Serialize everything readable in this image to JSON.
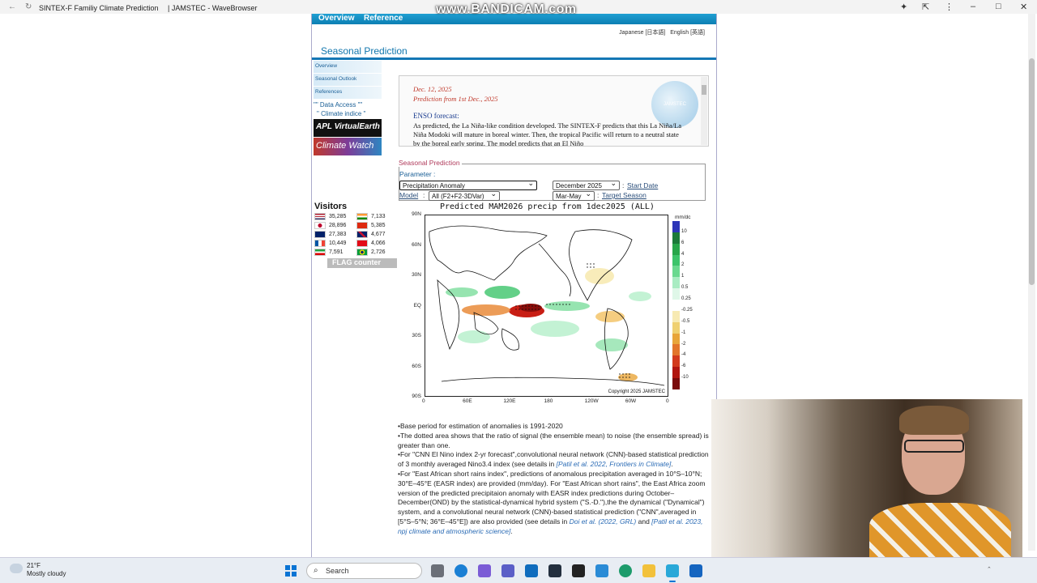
{
  "window": {
    "title": "SINTEX-F Familiy Climate Prediction 　| JAMSTEC - WaveBrowser"
  },
  "watermark": "www.BANDICAM.com",
  "topnav": {
    "items": [
      "Overview",
      "Reference"
    ]
  },
  "language": {
    "japanese": "Japanese [日本語]",
    "english": "English [英語]"
  },
  "page_title": "Seasonal Prediction",
  "sidebar": {
    "menu": [
      "Overview",
      "Seasonal Outlook",
      "References"
    ],
    "links": [
      "\"\" Data Access \"\"",
      "\" Climate indice \""
    ],
    "banners": [
      "APL VirtualEarth",
      "Climate Watch"
    ]
  },
  "visitors": {
    "title": "Visitors",
    "counts": [
      {
        "flag": "us",
        "count": "35,285"
      },
      {
        "flag": "in",
        "count": "7,133"
      },
      {
        "flag": "jp",
        "count": "28,896"
      },
      {
        "flag": "cn",
        "count": "5,385"
      },
      {
        "flag": "au",
        "count": "27,383"
      },
      {
        "flag": "gb",
        "count": "4,677"
      },
      {
        "flag": "fr",
        "count": "10,449"
      },
      {
        "flag": "tr",
        "count": "4,066"
      },
      {
        "flag": "ir",
        "count": "7,591"
      },
      {
        "flag": "br",
        "count": "2,726"
      }
    ],
    "flag_counter": "FLAG counter"
  },
  "news": {
    "date": "Dec. 12, 2025",
    "prediction_from": "Prediction from 1st Dec., 2025",
    "heading": "ENSO forecast:",
    "body": "As predicted, the La Niña-like condition developed. The SINTEX-F predicts that this La Niña/La Niña Modoki will mature in boreal winter. Then, the tropical Pacific will return to a neutral state by the boreal early spring. The model predicts that an El Niño",
    "logo_text": "JAMSTEC"
  },
  "seasonal_form": {
    "legend": "Seasonal Prediction",
    "parameter_label": "Parameter :",
    "parameter_value": "Precipitation Anomaly",
    "start_date_value": "December 2025",
    "start_date_label": "Start Date",
    "model_label": "Model",
    "model_value": "All (F2+F2-3DVar)",
    "target_season_value": "Mar-May",
    "target_season_label": "Target Season"
  },
  "map": {
    "title": "Predicted MAM2026 precip from 1dec2025 (ALL)",
    "y_ticks": [
      "90N",
      "60N",
      "30N",
      "EQ",
      "30S",
      "60S",
      "90S"
    ],
    "x_ticks": [
      "0",
      "60E",
      "120E",
      "180",
      "120W",
      "60W",
      "0"
    ],
    "copyright": "Copyright 2025 JAMSTEC",
    "unit": "mm/dc",
    "colorbar": {
      "labels": [
        "10",
        "6",
        "4",
        "2",
        "1",
        "0.5",
        "0.25",
        "-0.25",
        "-0.5",
        "-1",
        "-2",
        "-4",
        "-6",
        "-10"
      ],
      "colors": [
        "#2d36b8",
        "#1b7a3a",
        "#27a64a",
        "#3cc46a",
        "#6ad98f",
        "#a9ecc2",
        "#dff7e8",
        "#ffffff",
        "#f7eab3",
        "#efd071",
        "#e8a53a",
        "#e2752a",
        "#d23a1c",
        "#b1150f",
        "#7a0a0a"
      ]
    }
  },
  "notes": {
    "n1": "•Base period for estimation of anomalies is 1991-2020",
    "n2": "•The dotted area shows that the ratio of signal (the ensemble mean) to noise (the ensemble spread) is greater than one.",
    "n3": "•For \"CNN El Nino index 2-yr forecast\",convolutional neural network (CNN)-based statistical prediction of 3 monthly averaged Nino3.4 index (see details in ",
    "n3_link": "[Patil et al. 2022, Frontiers in Climate]",
    "n4": "•For \"East African short rains index\", predictions of anomalous precipitation averaged in 10°S–10°N; 30°E–45°E (EASR index) are provided (mm/day). For \"East African short rains\", the East Africa zoom version of the predicted precipitaion anomaly with EASR index predictions during October–December(OND) by the statistical-dynamical hybrid system (\"S.-D.\"),the the dynamical (\"Dynamical\") system, and a convolutional neural network (CNN)-based statistical prediction (\"CNN\",averaged in [5°S–5°N; 36°E–45°E]) are also provided (see details in ",
    "n4_link1": "Doi et al. (2022, GRL)",
    "n4_and": " and ",
    "n4_link2": "[Patil et al. 2023, npj climate and atmospheric science]",
    "n4_end": "."
  },
  "taskbar": {
    "weather_temp": "21°F",
    "weather_desc": "Mostly cloudy",
    "search_placeholder": "Search"
  }
}
